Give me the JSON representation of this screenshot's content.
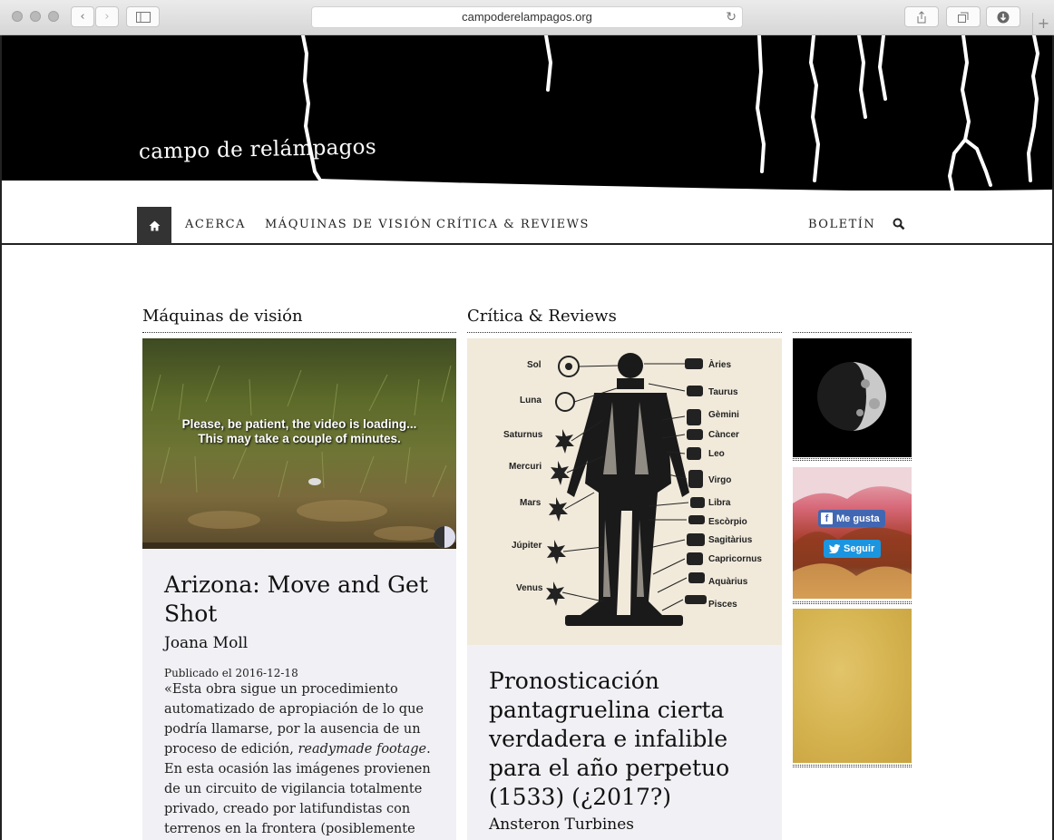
{
  "browser": {
    "url": "campoderelampagos.org",
    "icons": [
      "back-icon",
      "forward-icon",
      "sidebar-icon",
      "reload-icon",
      "share-icon",
      "tabs-icon",
      "download-icon",
      "new-tab-icon"
    ]
  },
  "site": {
    "title": "campo de relámpagos"
  },
  "nav": {
    "items": [
      "ACERCA",
      "MÁQUINAS DE VISIÓN",
      "CRÍTICA & REVIEWS"
    ],
    "right_item": "BOLETÍN",
    "icons": [
      "home-icon",
      "search-icon"
    ]
  },
  "columns": {
    "left": {
      "title": "Máquinas de visión",
      "video_overlay_line1": "Please, be patient, the video is loading...",
      "video_overlay_line2": "This may take a couple of minutes.",
      "post": {
        "title": "Arizona: Move and Get Shot",
        "author": "Joana Moll",
        "date_label": "Publicado el 2016-12-18",
        "excerpt_start": "«Esta obra sigue un procedimiento automatizado de apropiación de lo que podría llamarse, por la ausencia de un proceso de edición, ",
        "excerpt_italic": "readymade footage",
        "excerpt_end": ". En esta ocasión las imágenes provienen de un circuito de vigilancia totalmente privado, creado por latifundistas con terrenos en la frontera (posiblemente con"
      }
    },
    "middle": {
      "title": "Crítica & Reviews",
      "zodiac_labels_left": [
        "Sol",
        "Luna",
        "Saturnus",
        "Mercuri",
        "Mars",
        "Júpiter",
        "Venus"
      ],
      "zodiac_labels_right": [
        "Àries",
        "Taurus",
        "Gèmini",
        "Càncer",
        "Leo",
        "Virgo",
        "Libra",
        "Escòrpio",
        "Sagitàrius",
        "Capricornus",
        "Aquàrius",
        "Pisces"
      ],
      "post": {
        "title": "Pronosticación pantagruelina cierta verdadera e infalible para el año perpetuo (1533) (¿2017?)",
        "author": "Ansteron Turbines"
      }
    },
    "sidebar": {
      "facebook_label": "Me gusta",
      "twitter_label": "Seguir"
    }
  },
  "colors": {
    "header_bg": "#000000",
    "nav_home_bg": "#333333",
    "card_bg": "#f0f0f5",
    "facebook": "#4267b2",
    "twitter": "#1b95e0"
  }
}
